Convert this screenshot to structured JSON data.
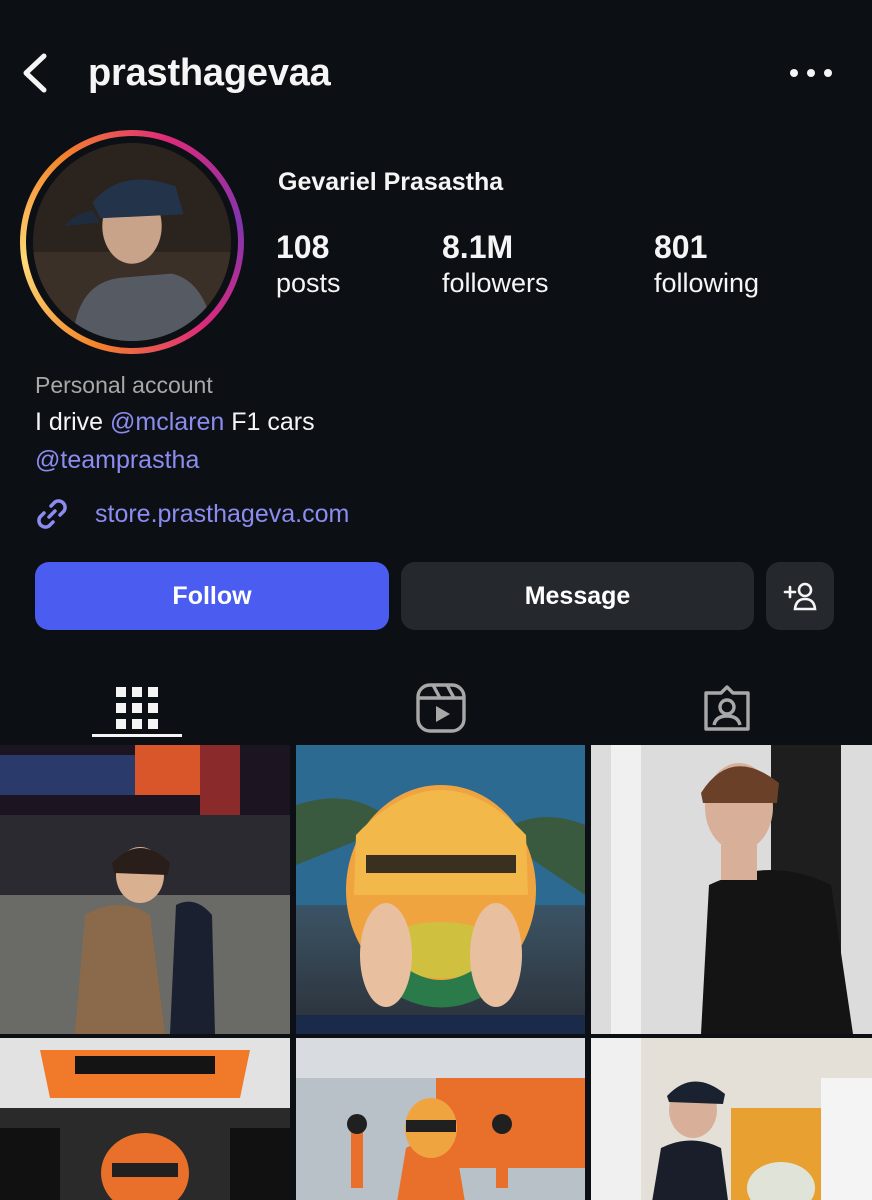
{
  "header": {
    "username": "prasthagevaa"
  },
  "profile": {
    "display_name": "Gevariel Prasastha",
    "stats": {
      "posts": {
        "value": "108",
        "label": "posts"
      },
      "followers": {
        "value": "8.1M",
        "label": "followers"
      },
      "following": {
        "value": "801",
        "label": "following"
      }
    },
    "category": "Personal account",
    "bio": {
      "prefix": "I drive ",
      "mention": "@mclaren",
      "suffix": " F1 cars",
      "second_line": "@teamprastha"
    },
    "link": "store.prasthageva.com"
  },
  "actions": {
    "follow_label": "Follow",
    "message_label": "Message"
  },
  "tabs": [
    {
      "name": "grid",
      "icon": "grid-icon",
      "active": true
    },
    {
      "name": "reels",
      "icon": "reels-icon",
      "active": false
    },
    {
      "name": "tagged",
      "icon": "tagged-icon",
      "active": false
    }
  ],
  "colors": {
    "background": "#0c1014",
    "follow_button": "#4a5df0",
    "secondary_button": "#25292e",
    "link": "#8c8cf0",
    "muted_text": "#a8a8a8"
  }
}
